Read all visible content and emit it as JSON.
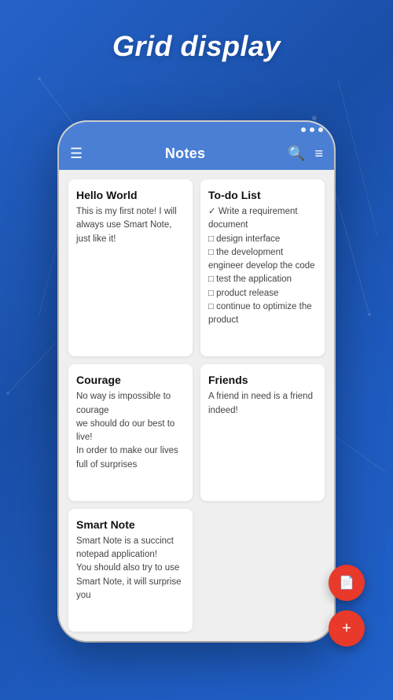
{
  "page": {
    "title": "Grid display",
    "background_color": "#2563c9"
  },
  "toolbar": {
    "title": "Notes",
    "menu_icon": "☰",
    "search_icon": "🔍",
    "filter_icon": "≡"
  },
  "notes": [
    {
      "id": "hello-world",
      "title": "Hello World",
      "body": "This is my first note! I will always use Smart Note, just like it!"
    },
    {
      "id": "todo-list",
      "title": "To-do List",
      "body": "✓ Write a requirement document\n□ design interface\n□ the development engineer develop the code\n□ test the application\n□ product release\n□ continue to optimize the product"
    },
    {
      "id": "courage",
      "title": "Courage",
      "body": "No way is impossible to courage\nwe should do our best to live!\nIn order to make our lives full of surprises"
    },
    {
      "id": "friends",
      "title": "Friends",
      "body": "A friend in need is a friend indeed!"
    },
    {
      "id": "smart-note",
      "title": "Smart Note",
      "body": "Smart Note is a succinct notepad application!\nYou should also try to use Smart Note, it will surprise you"
    }
  ],
  "fab": {
    "doc_icon": "📄",
    "add_icon": "+"
  }
}
